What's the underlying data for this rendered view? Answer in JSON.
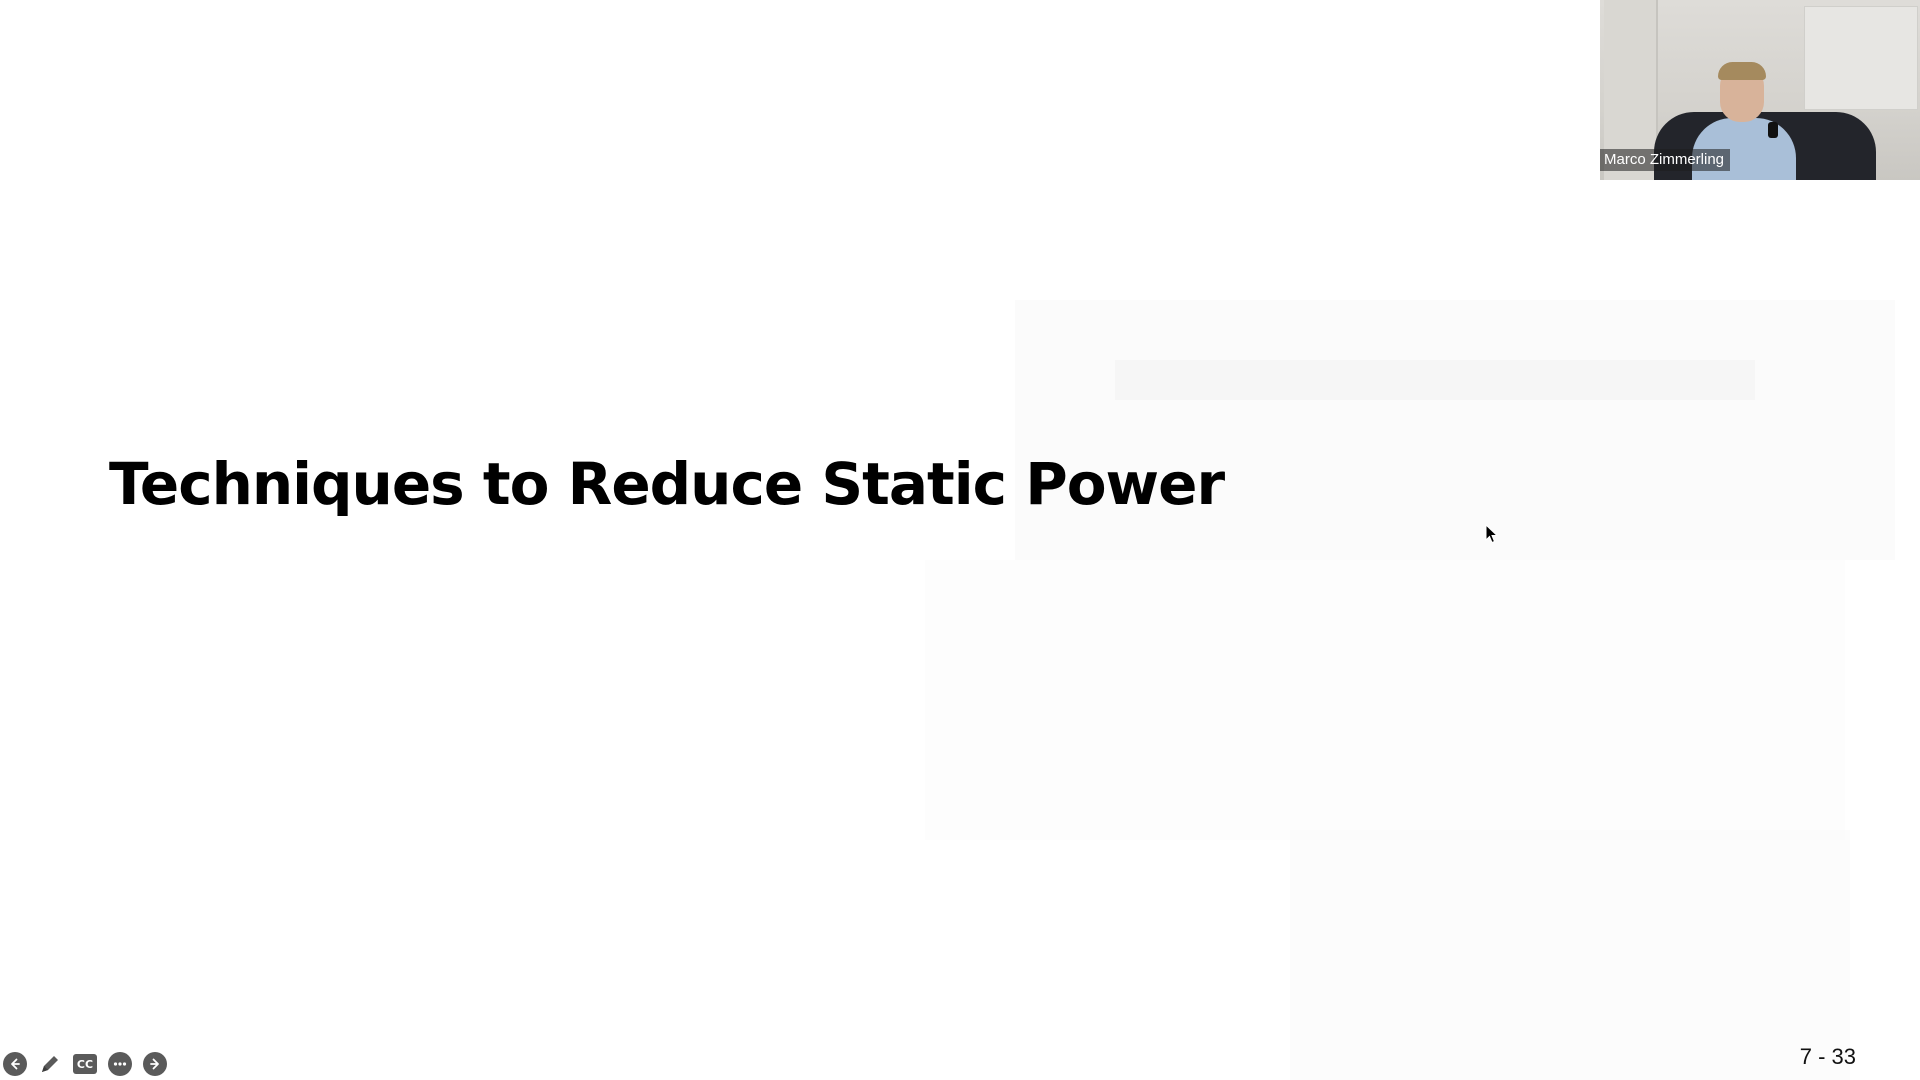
{
  "slide": {
    "title": "Techniques to Reduce Static Power",
    "number": "7 - 33"
  },
  "video": {
    "participant_name": "Marco Zimmerling"
  },
  "toolbar": {
    "buttons": [
      {
        "icon": "arrow-left-icon"
      },
      {
        "icon": "pen-icon"
      },
      {
        "icon": "closed-captions-icon",
        "label": "CC"
      },
      {
        "icon": "more-options-icon"
      },
      {
        "icon": "arrow-right-icon"
      }
    ]
  },
  "colors": {
    "background": "#ffffff",
    "title": "#000000",
    "toolbar_icon": "#5a5a5a"
  }
}
